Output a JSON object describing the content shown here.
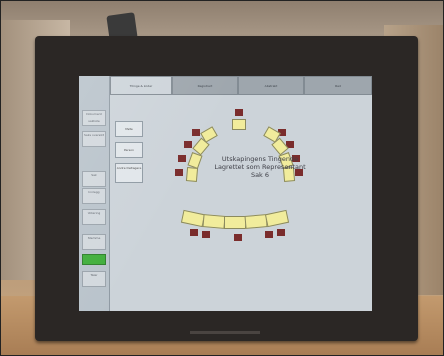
{
  "tabs": [
    {
      "label": "Tilinge & koder"
    },
    {
      "label": "Registrert"
    },
    {
      "label": "Abstrakt"
    },
    {
      "label": "Rad"
    }
  ],
  "side_buttons": [
    {
      "label": "Dokument sakliste"
    },
    {
      "label": "Saks oversikt"
    },
    {
      "label": "Sak"
    },
    {
      "label": "Innlegg"
    },
    {
      "label": "Votering"
    },
    {
      "label": "Stemme"
    },
    {
      "label": ""
    },
    {
      "label": "Taler"
    }
  ],
  "panel_buttons": [
    {
      "label": "Møte"
    },
    {
      "label": "Person"
    },
    {
      "label": "Andre Deltagere"
    }
  ],
  "caption_lines": [
    "Utskapingens Tingende",
    "Lagrettet som Representant",
    "Sak 6"
  ],
  "colors": {
    "seat": "#f1ec9c",
    "chair": "#7a2c2c",
    "active_indicator": "#3fae3a",
    "screen_bg": "#c4ccd3"
  }
}
